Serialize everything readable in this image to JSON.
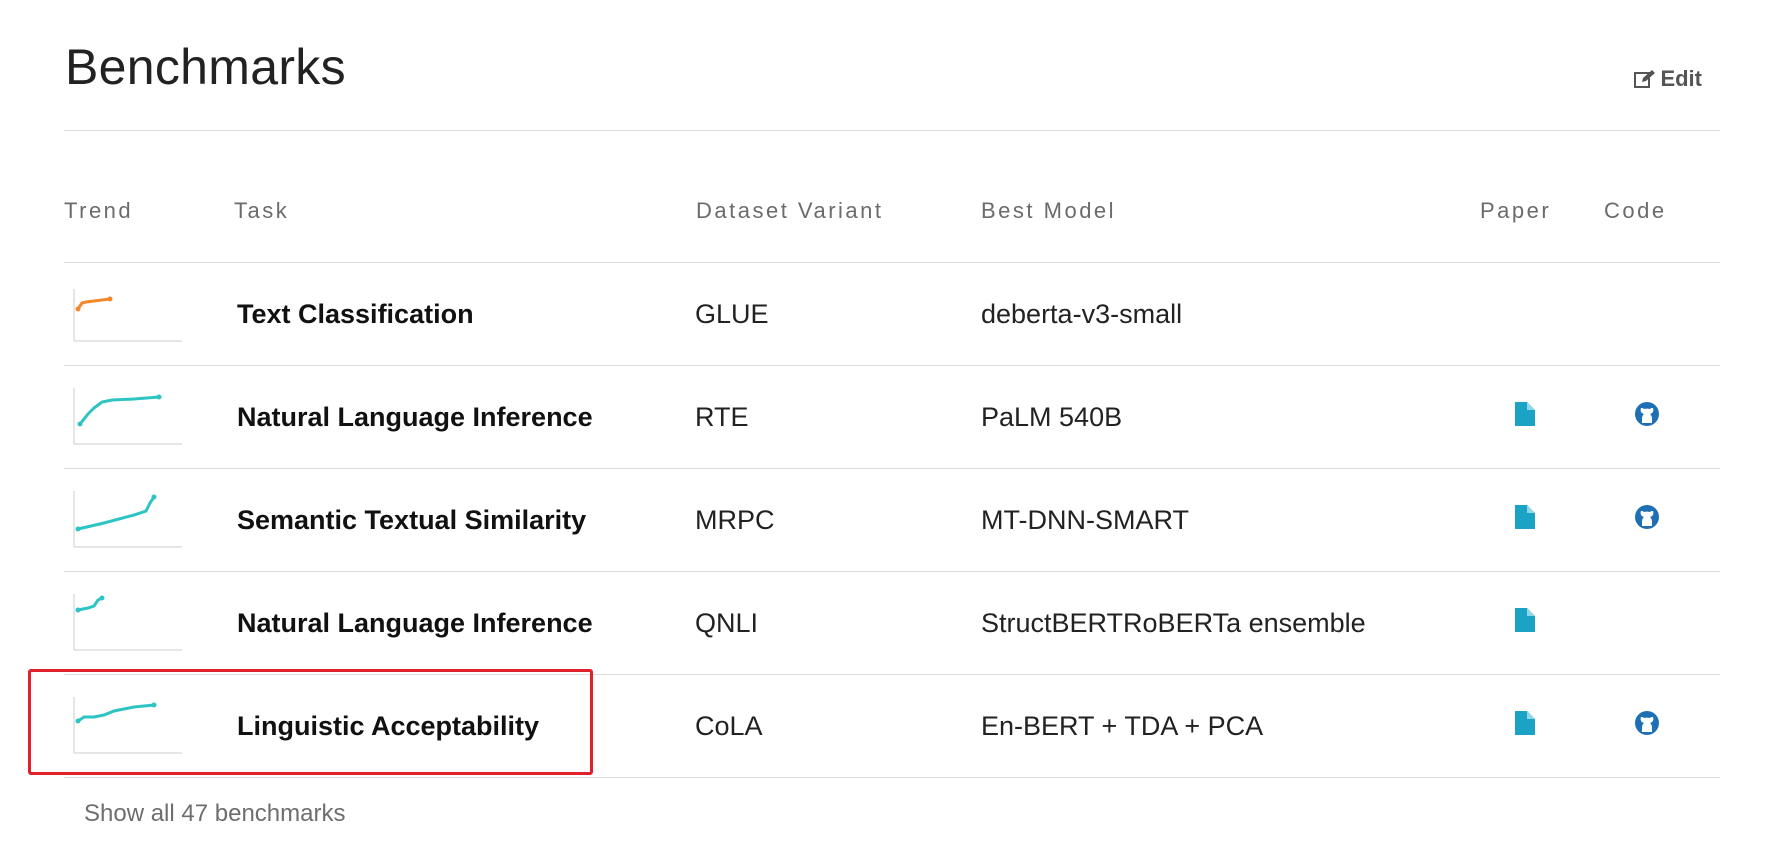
{
  "page": {
    "title": "Benchmarks",
    "edit_label": "Edit"
  },
  "table": {
    "headers": {
      "trend": "Trend",
      "task": "Task",
      "dataset": "Dataset Variant",
      "model": "Best Model",
      "paper": "Paper",
      "code": "Code"
    },
    "rows": [
      {
        "task": "Text Classification",
        "dataset": "GLUE",
        "model": "deberta-v3-small",
        "has_paper": false,
        "has_code": false,
        "trend_color": "#f5872b"
      },
      {
        "task": "Natural Language Inference",
        "dataset": "RTE",
        "model": "PaLM 540B",
        "has_paper": true,
        "has_code": true,
        "trend_color": "#2ec4c4"
      },
      {
        "task": "Semantic Textual Similarity",
        "dataset": "MRPC",
        "model": "MT-DNN-SMART",
        "has_paper": true,
        "has_code": true,
        "trend_color": "#2ec4c4"
      },
      {
        "task": "Natural Language Inference",
        "dataset": "QNLI",
        "model": "StructBERTRoBERTa ensemble",
        "has_paper": true,
        "has_code": false,
        "trend_color": "#2ec4c4"
      },
      {
        "task": "Linguistic Acceptability",
        "dataset": "CoLA",
        "model": "En-BERT + TDA + PCA",
        "has_paper": true,
        "has_code": true,
        "trend_color": "#2ec4c4"
      }
    ]
  },
  "show_all_label": "Show all 47 benchmarks",
  "colors": {
    "accent": "#1aa3c4",
    "github": "#1f6fb5",
    "highlight": "#e0202a"
  },
  "icons": {
    "edit": "edit-icon",
    "paper": "paper-icon",
    "code": "github-icon"
  }
}
